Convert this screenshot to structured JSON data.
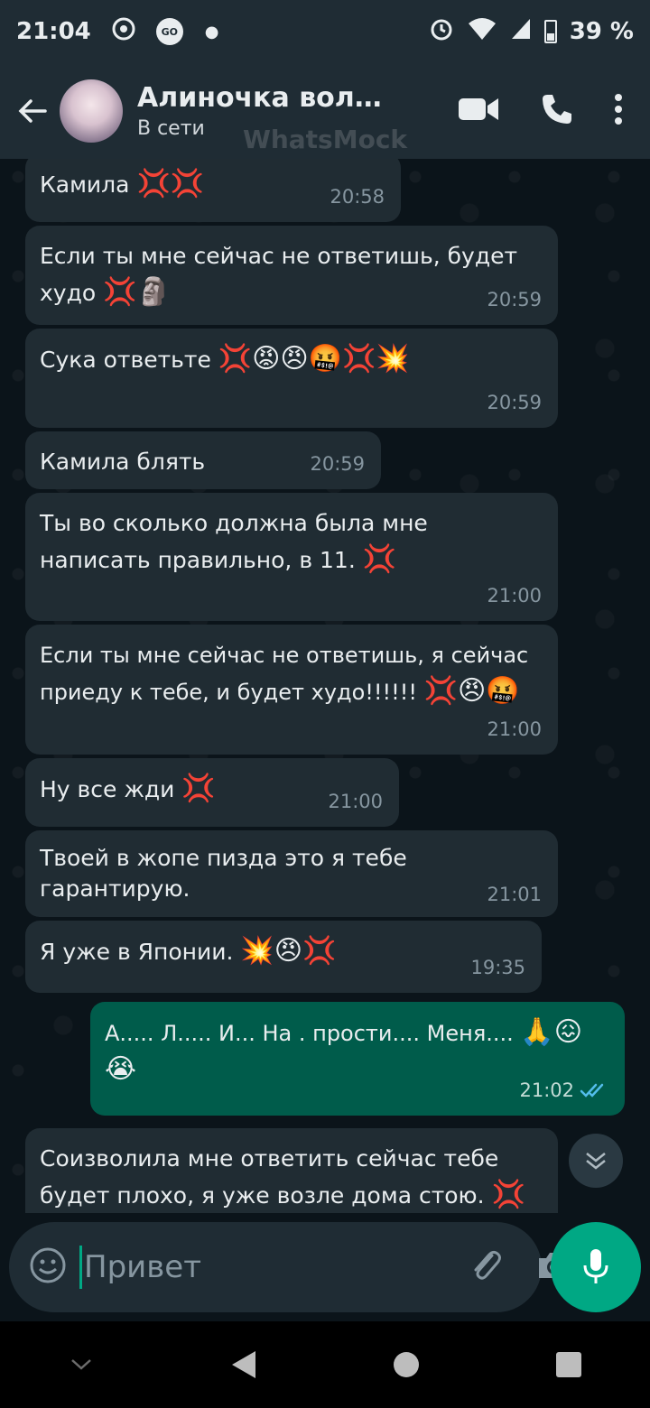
{
  "status_bar": {
    "time": "21:04",
    "battery": "39 %"
  },
  "header": {
    "contact_name": "Алиночка волчо...",
    "status": "В сети",
    "watermark": "WhatsMock"
  },
  "messages": [
    {
      "text": "Камила",
      "emoji": "💢💢",
      "time": "20:58",
      "direction": "in"
    },
    {
      "text": "Если ты мне сейчас не ответишь, будет худо",
      "emoji": "💢🗿",
      "time": "20:59",
      "direction": "in"
    },
    {
      "text": "Сука ответьте",
      "emoji": "💢😡😠🤬💢💥",
      "time": "20:59",
      "direction": "in"
    },
    {
      "text": "Камила блять",
      "emoji": "",
      "time": "20:59",
      "direction": "in"
    },
    {
      "text": "Ты во сколько должна была мне написать правильно, в 11.",
      "emoji": "💢",
      "time": "21:00",
      "direction": "in"
    },
    {
      "text": "Если ты мне сейчас не ответишь, я сейчас приеду к тебе, и будет худо!!!!!!",
      "emoji": "💢😠🤬",
      "time": "21:00",
      "direction": "in"
    },
    {
      "text": "Ну все жди",
      "emoji": "💢",
      "time": "21:00",
      "direction": "in"
    },
    {
      "text": "Твоей в жопе пизда это я тебе гарантирую.",
      "emoji": "",
      "time": "21:01",
      "direction": "in"
    },
    {
      "text": "Я уже в Японии.",
      "emoji": "💥😠💢",
      "time": "19:35",
      "direction": "in"
    },
    {
      "text": "А..... Л..... И... На . прости.... Меня....",
      "emoji": "🙏😖😭",
      "time": "21:02",
      "direction": "out"
    },
    {
      "text": "Соизволила мне ответить сейчас тебе будет плохо, я уже возле дома стою.",
      "emoji": "💢",
      "time": "",
      "direction": "in"
    }
  ],
  "input": {
    "value": "Привет"
  },
  "colors": {
    "header": "#1f2c34",
    "incoming": "#202c33",
    "outgoing": "#005c4b",
    "accent": "#00a884",
    "read_ticks": "#53bdeb"
  }
}
